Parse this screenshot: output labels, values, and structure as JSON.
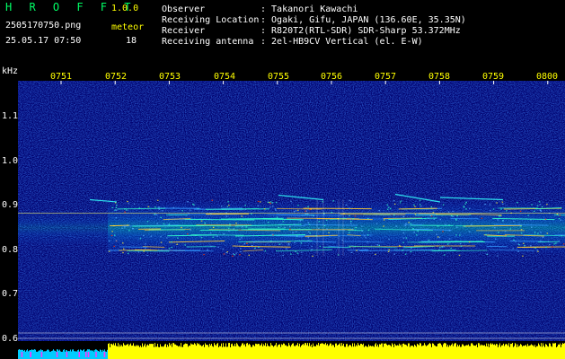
{
  "app": {
    "logo": "H R O F F T",
    "version": "1.0.0",
    "filename": "2505170750.png",
    "datetime": "25.05.17 07:50",
    "meteor_label": "meteor",
    "meteor_count": "18"
  },
  "header": {
    "rows": [
      {
        "label": "Observer",
        "value": ": Takanori Kawachi"
      },
      {
        "label": "Receiving Location",
        "value": ": Ogaki, Gifu, JAPAN (136.60E, 35.35N)"
      },
      {
        "label": "Receiver",
        "value": ": R820T2(RTL-SDR) SDR-Sharp 53.372MHz"
      },
      {
        "label": "Receiving antenna",
        "value": ": 2el-HB9CV Vertical (el. E-W)"
      }
    ]
  },
  "axes": {
    "y_unit": "kHz",
    "x_ticks": [
      "0751",
      "0752",
      "0753",
      "0754",
      "0755",
      "0756",
      "0757",
      "0758",
      "0759",
      "0800"
    ],
    "y_ticks": [
      "1.1",
      "1.0",
      "0.9",
      "0.8",
      "0.7",
      "0.6"
    ]
  },
  "colors": {
    "background": "#000000",
    "spectrogram_base": "#00007a",
    "logo": "#00ff66",
    "accent": "#ffff00",
    "signal_band": "#00ffcc",
    "power_bar": "#ffff00",
    "early_power_bar": "#00ccff"
  },
  "chart_data": {
    "type": "heatmap",
    "title": "",
    "xlabel": "",
    "ylabel": "kHz",
    "x": [
      "0751",
      "0752",
      "0753",
      "0754",
      "0755",
      "0756",
      "0757",
      "0758",
      "0759",
      "0800"
    ],
    "ylim": [
      0.6,
      1.14
    ],
    "reference_lines_khz": [
      0.895
    ],
    "meteor_count": 18
  }
}
